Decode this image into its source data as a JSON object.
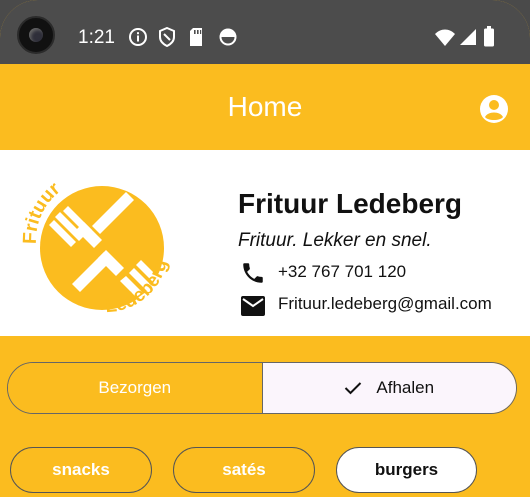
{
  "status_bar": {
    "time": "1:21",
    "icons": [
      "info-icon",
      "shield-icon",
      "sd-card-icon",
      "sync-icon",
      "wifi-icon",
      "cell-signal-icon",
      "battery-icon"
    ]
  },
  "app_bar": {
    "title": "Home",
    "account_icon": "account-circle-icon"
  },
  "shop": {
    "logo_text_top": "Frituur",
    "logo_text_bottom": "Ledeberg",
    "name": "Frituur Ledeberg",
    "slogan": "Frituur. Lekker en snel.",
    "phone": "+32 767 701 120",
    "email": "Frituur.ledeberg@gmail.com"
  },
  "delivery_toggle": {
    "options": [
      "Bezorgen",
      "Afhalen"
    ],
    "selected": "Afhalen"
  },
  "categories": {
    "items": [
      "snacks",
      "satés",
      "burgers"
    ],
    "selected": "burgers"
  },
  "colors": {
    "brand": "#FBBC1F",
    "status_bar": "#4C4C4C",
    "selected_segment": "#FBF5FC"
  }
}
